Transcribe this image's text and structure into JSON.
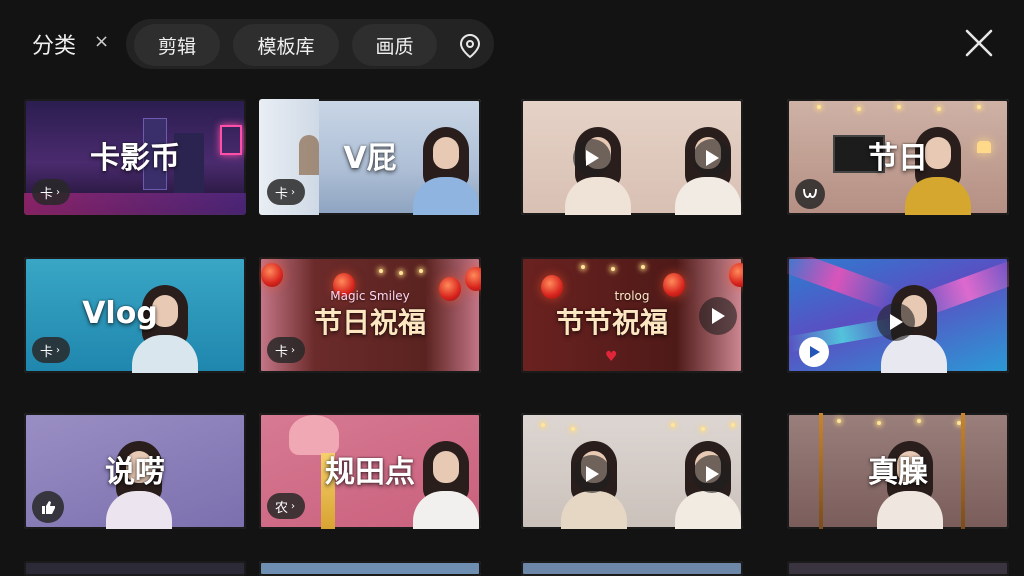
{
  "header": {
    "category_label": "分类",
    "clear_symbol": "×",
    "chips": [
      {
        "label": "剪辑"
      },
      {
        "label": "模板库"
      },
      {
        "label": "画质"
      }
    ]
  },
  "tiles": [
    {
      "title": "卡影币",
      "subtitle": "",
      "badge": "卡",
      "badge_icon": "chevron-right-icon",
      "play": false
    },
    {
      "title": "V屁",
      "subtitle": "",
      "badge": "卡",
      "badge_icon": "chevron-right-icon",
      "play": false
    },
    {
      "title": "",
      "subtitle": "",
      "badge": "",
      "badge_icon": "",
      "play": true
    },
    {
      "title": "节日",
      "subtitle": "",
      "badge": "",
      "badge_icon": "swirl-icon",
      "play": false
    },
    {
      "title": "Vlog",
      "subtitle": "",
      "badge": "卡",
      "badge_icon": "chevron-right-icon",
      "play": false
    },
    {
      "title": "节日祝福",
      "subtitle": "Magic Smiley",
      "badge": "卡",
      "badge_icon": "chevron-right-icon",
      "play": false
    },
    {
      "title": "节节祝福",
      "subtitle": "trolog",
      "badge": "",
      "badge_icon": "",
      "play": true
    },
    {
      "title": "",
      "subtitle": "",
      "badge": "",
      "badge_icon": "play-circle-icon",
      "play": true
    },
    {
      "title": "说唠",
      "subtitle": "",
      "badge": "",
      "badge_icon": "thumbs-up-icon",
      "play": false
    },
    {
      "title": "规田点",
      "subtitle": "",
      "badge": "农",
      "badge_icon": "chevron-right-icon",
      "play": false
    },
    {
      "title": "",
      "subtitle": "",
      "badge": "",
      "badge_icon": "",
      "play": true
    },
    {
      "title": "真臊",
      "subtitle": "",
      "badge": "",
      "badge_icon": "",
      "play": false
    }
  ]
}
